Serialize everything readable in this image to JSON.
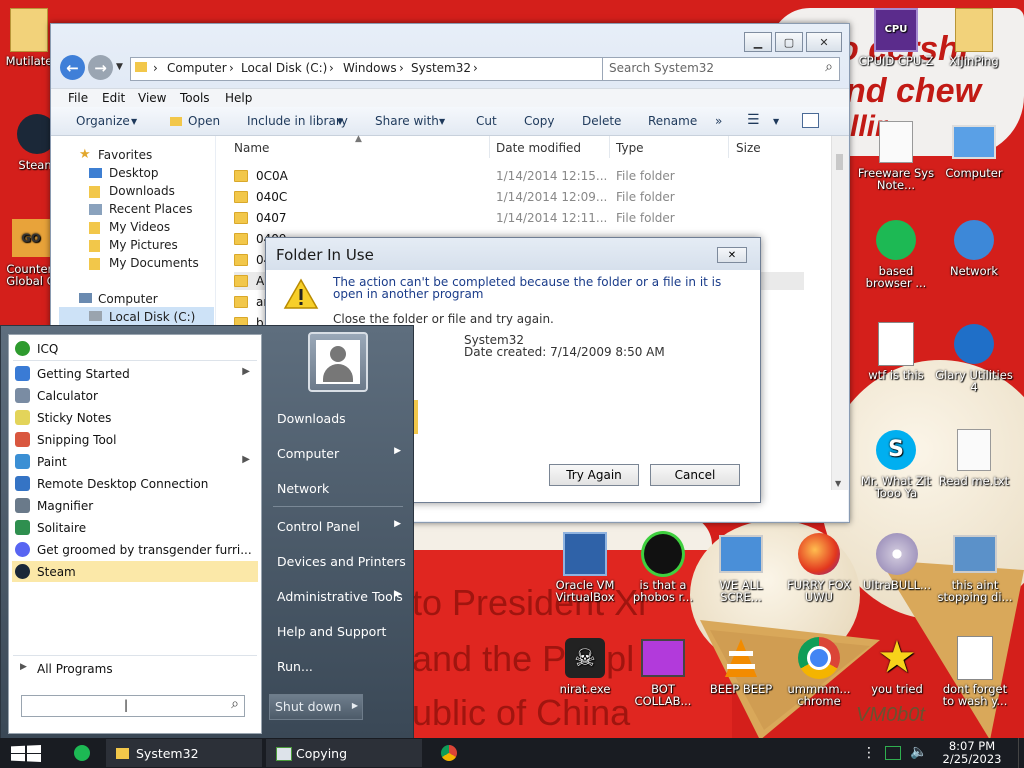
{
  "wallpaper": {
    "top_text_1": "o cershi",
    "top_text_2": "nd chew",
    "top_text_3": "llir",
    "bottom_text_1": "to President Xi",
    "bottom_text_2": "and the Peopl",
    "bottom_text_3": "ublic of China",
    "signature": "VM0b0t"
  },
  "desktop_icons": [
    {
      "label": "Mutilate",
      "icon": "folder-icon"
    },
    {
      "label": "Steam",
      "icon": "steam-icon"
    },
    {
      "label": "Counter-Global O",
      "icon": "csgo-icon"
    },
    {
      "label": "CPUID CPU-Z",
      "icon": "cpuz-icon"
    },
    {
      "label": "XiJinPing",
      "icon": "folder-icon"
    },
    {
      "label": "Freeware Sys Note...",
      "icon": "document-icon"
    },
    {
      "label": "Computer",
      "icon": "computer-icon"
    },
    {
      "label": "based browser ...",
      "icon": "browser-icon"
    },
    {
      "label": "Network",
      "icon": "network-icon"
    },
    {
      "label": "wtf is this",
      "icon": "document-icon"
    },
    {
      "label": "Glary Utilities 4",
      "icon": "glary-icon"
    },
    {
      "label": "Mr. What Zit Tooo Ya",
      "icon": "skype-icon"
    },
    {
      "label": "Read me.txt",
      "icon": "text-file-icon"
    },
    {
      "label": "Oracle VM VirtualBox",
      "icon": "virtualbox-icon"
    },
    {
      "label": "is that a phobos r...",
      "icon": "icq-icon"
    },
    {
      "label": "WE ALL SCRE...",
      "icon": "computer-icon"
    },
    {
      "label": "FURRY FOX UWU",
      "icon": "firefox-icon"
    },
    {
      "label": "UltraBULL...",
      "icon": "disc-icon"
    },
    {
      "label": "this aint stopping di...",
      "icon": "computer-icon"
    },
    {
      "label": "nirat.exe",
      "icon": "skull-icon"
    },
    {
      "label": "BOT COLLAB...",
      "icon": "monitor-icon"
    },
    {
      "label": "BEEP BEEP",
      "icon": "vlc-icon"
    },
    {
      "label": "ummmm... chrome",
      "icon": "chrome-icon"
    },
    {
      "label": "you tried",
      "icon": "star-icon"
    },
    {
      "label": "dont forget to wash y...",
      "icon": "document-icon"
    }
  ],
  "explorer": {
    "breadcrumb": [
      "Computer",
      "Local Disk (C:)",
      "Windows",
      "System32"
    ],
    "search_placeholder": "Search System32",
    "menu": [
      "File",
      "Edit",
      "View",
      "Tools",
      "Help"
    ],
    "toolbar": [
      "Organize",
      "Open",
      "Include in library",
      "Share with",
      "Cut",
      "Copy",
      "Delete",
      "Rename",
      "»"
    ],
    "nav": {
      "favorites": "Favorites",
      "favorite_items": [
        "Desktop",
        "Downloads",
        "Recent Places",
        "My Videos",
        "My Pictures",
        "My Documents"
      ],
      "computer": "Computer",
      "local_disk": "Local Disk (C:)"
    },
    "columns": [
      "Name",
      "Date modified",
      "Type",
      "Size"
    ],
    "rows": [
      {
        "name": "0C0A",
        "date": "1/14/2014 12:15...",
        "type": "File folder"
      },
      {
        "name": "040C",
        "date": "1/14/2014 12:09...",
        "type": "File folder"
      },
      {
        "name": "0407",
        "date": "1/14/2014 12:11...",
        "type": "File folder"
      },
      {
        "name": "0409",
        "date": "",
        "type": ""
      },
      {
        "name": "04",
        "date": "",
        "type": ""
      },
      {
        "name": "A",
        "date": "",
        "type": ""
      },
      {
        "name": "ar",
        "date": "",
        "type": ""
      },
      {
        "name": "b",
        "date": "",
        "type": ""
      }
    ]
  },
  "dialog": {
    "title": "Folder In Use",
    "message": "The action can't be completed because the folder or a file in it is open in another program",
    "instruction": "Close the folder or file and try again.",
    "item_name": "System32",
    "item_date": "Date created: 7/14/2009 8:50 AM",
    "try_again": "Try Again",
    "cancel": "Cancel"
  },
  "start_menu": {
    "left_items": [
      {
        "label": "ICQ",
        "arrow": false,
        "color": "#2e9b2e"
      },
      {
        "label": "Getting Started",
        "arrow": true,
        "color": "#3a7bd5"
      },
      {
        "label": "Calculator",
        "arrow": false,
        "color": "#7a8ca3"
      },
      {
        "label": "Sticky Notes",
        "arrow": false,
        "color": "#e3d45a"
      },
      {
        "label": "Snipping Tool",
        "arrow": false,
        "color": "#d9573f"
      },
      {
        "label": "Paint",
        "arrow": true,
        "color": "#3b8fd4"
      },
      {
        "label": "Remote Desktop Connection",
        "arrow": false,
        "color": "#3574c5"
      },
      {
        "label": "Magnifier",
        "arrow": false,
        "color": "#6a7a8a"
      },
      {
        "label": "Solitaire",
        "arrow": false,
        "color": "#2f8f4f"
      },
      {
        "label": "Get groomed by transgender furri...",
        "arrow": false,
        "color": "#5865f2"
      },
      {
        "label": "Steam",
        "arrow": false,
        "color": "#1b2838"
      }
    ],
    "all_programs": "All Programs",
    "search_text": "|",
    "right_items": [
      {
        "label": "Downloads",
        "arrow": false
      },
      {
        "label": "Computer",
        "arrow": true
      },
      {
        "label": "Network",
        "arrow": false
      },
      {
        "label": "Control Panel",
        "arrow": true
      },
      {
        "label": "Devices and Printers",
        "arrow": false
      },
      {
        "label": "Administrative Tools",
        "arrow": true
      },
      {
        "label": "Help and Support",
        "arrow": false
      },
      {
        "label": "Run...",
        "arrow": false
      }
    ],
    "shutdown": "Shut down"
  },
  "taskbar": {
    "tasks": [
      "System32",
      "Copying"
    ],
    "time": "8:07 PM",
    "date": "2/25/2023"
  },
  "colors": {
    "wallpaper_red": "#d41f1b",
    "highlight": "#fbe8a8"
  }
}
